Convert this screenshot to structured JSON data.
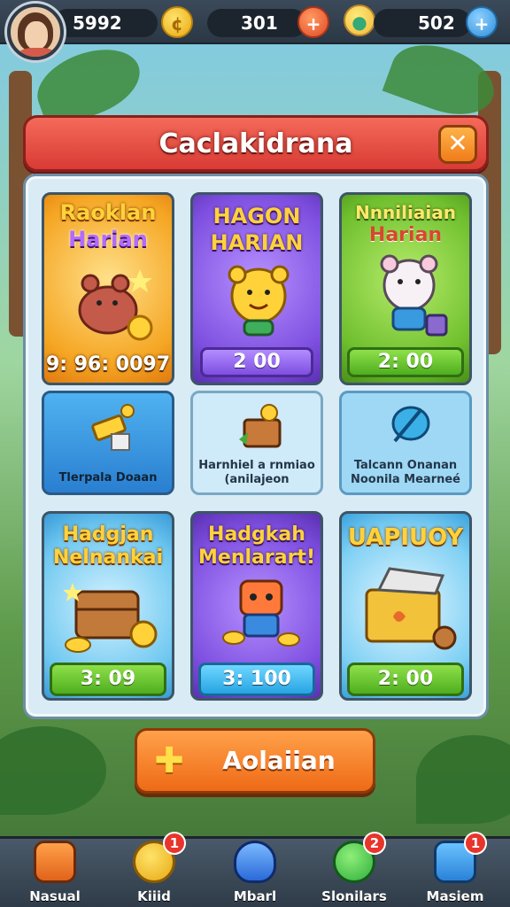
{
  "hud": {
    "player_coins_a": "5992",
    "resource_b": "301",
    "resource_c": "502"
  },
  "panel": {
    "title": "Caclakidrana",
    "close_icon": "close-icon"
  },
  "cards": {
    "row1": [
      {
        "title_line1": "Raoklan",
        "title_line2": "Harian",
        "timer": "9: 96: 0097",
        "color": "#f5a623"
      },
      {
        "title_line1": "HAGON",
        "title_line2": "HARIAN",
        "timer": "2 00",
        "color": "#8a4fe0"
      },
      {
        "title_line1": "Nnniliaian",
        "title_line2": "Harian",
        "timer": "2: 00",
        "color": "#6fbf2e"
      }
    ],
    "row2": [
      {
        "label_line1": "Tlerpala Doaan",
        "label_line2": ""
      },
      {
        "label_line1": "Harnhiel a rnmiao",
        "label_line2": "(anilajeon"
      },
      {
        "label_line1": "Talcann Onanan",
        "label_line2": "Noonila Mearneé"
      }
    ],
    "row3": [
      {
        "title_line1": "Hadgjan",
        "title_line2": "Nelnankai",
        "timer": "3: 09"
      },
      {
        "title_line1": "Hadgkah",
        "title_line2": "Menlarart!",
        "timer": "3: 100"
      },
      {
        "title_line1": "UAPIUOY",
        "title_line2": "",
        "timer": "2: 00"
      }
    ]
  },
  "action_button": {
    "label": "Aolaiian"
  },
  "bottom_nav": [
    {
      "label": "Nasual",
      "badge": ""
    },
    {
      "label": "Kiiid",
      "badge": "1"
    },
    {
      "label": "Mbarl",
      "badge": ""
    },
    {
      "label": "Slonilars",
      "badge": "2"
    },
    {
      "label": "Masiem",
      "badge": "1"
    }
  ]
}
